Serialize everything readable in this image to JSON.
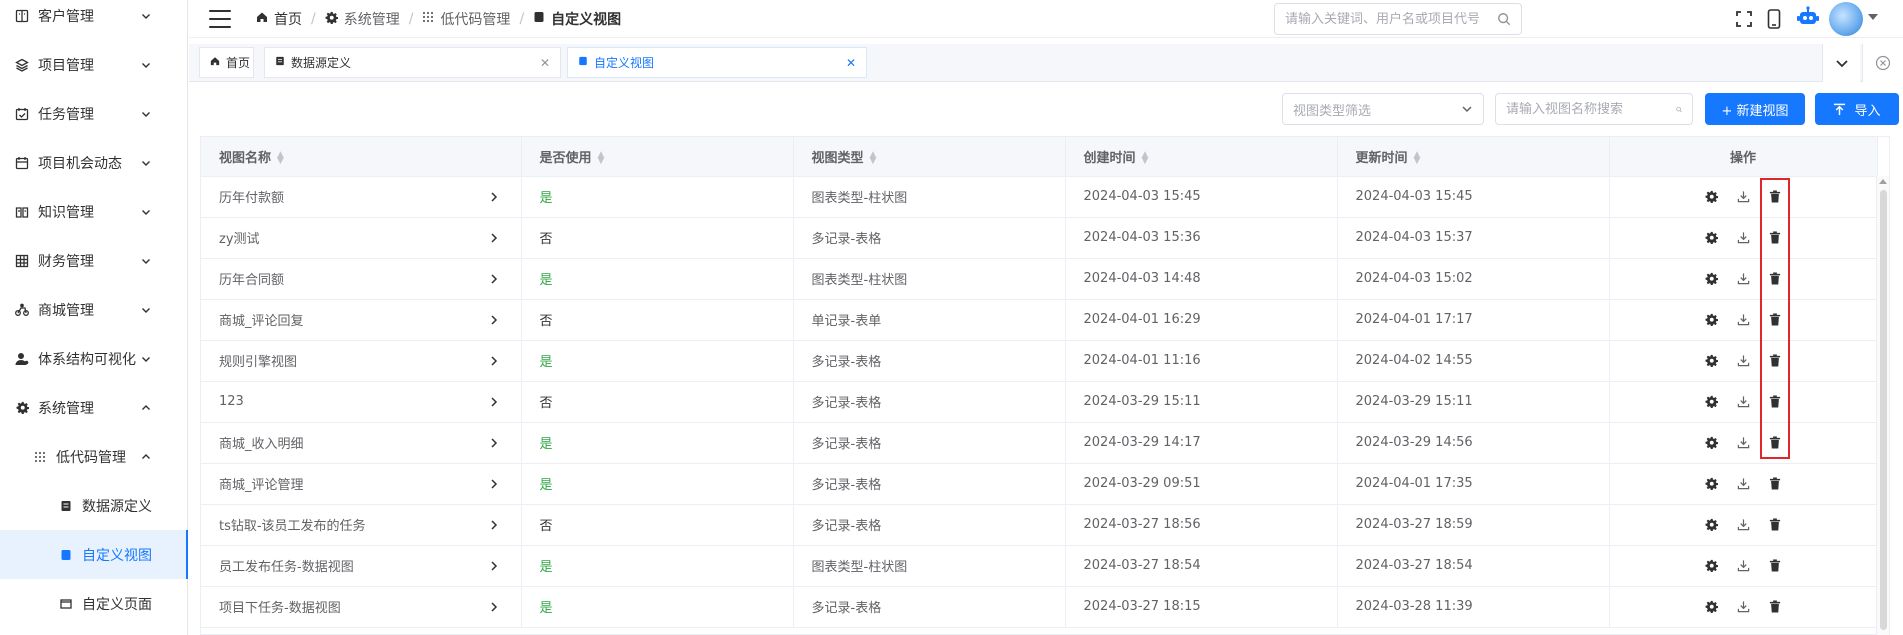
{
  "sidebar": {
    "items": [
      {
        "label": "客户管理",
        "icon": "customer-icon",
        "expanded": false
      },
      {
        "label": "项目管理",
        "icon": "layers-icon",
        "expanded": false
      },
      {
        "label": "任务管理",
        "icon": "calendar-check-icon",
        "expanded": false
      },
      {
        "label": "项目机会动态",
        "icon": "calendar-icon",
        "expanded": false
      },
      {
        "label": "知识管理",
        "icon": "book-icon",
        "expanded": false
      },
      {
        "label": "财务管理",
        "icon": "grid-icon",
        "expanded": false
      },
      {
        "label": "商城管理",
        "icon": "bike-icon",
        "expanded": false
      },
      {
        "label": "体系结构可视化",
        "icon": "user-icon",
        "expanded": false
      },
      {
        "label": "系统管理",
        "icon": "gear-icon",
        "expanded": true
      }
    ],
    "submenu": {
      "label": "低代码管理",
      "icon": "dots-grid-icon",
      "expanded": true
    },
    "subitems": [
      {
        "label": "数据源定义",
        "icon": "database-icon",
        "active": false
      },
      {
        "label": "自定义视图",
        "icon": "view-icon",
        "active": true
      },
      {
        "label": "自定义页面",
        "icon": "window-icon",
        "active": false
      }
    ]
  },
  "header": {
    "breadcrumb": [
      {
        "label": "首页",
        "icon": "home-icon"
      },
      {
        "label": "系统管理",
        "icon": "gear-icon"
      },
      {
        "label": "低代码管理",
        "icon": "dots-grid-icon"
      },
      {
        "label": "自定义视图",
        "icon": "view-icon"
      }
    ],
    "search_placeholder": "请输入关键词、用户名或项目代号"
  },
  "tabs": [
    {
      "label": "首页",
      "icon": "home-icon",
      "closable": false,
      "active": false
    },
    {
      "label": "数据源定义",
      "icon": "database-icon",
      "closable": true,
      "active": false
    },
    {
      "label": "自定义视图",
      "icon": "view-icon",
      "closable": true,
      "active": true
    }
  ],
  "toolbar": {
    "view_type_placeholder": "视图类型筛选",
    "name_search_placeholder": "请输入视图名称搜索",
    "new_view_label": "+ 新建视图",
    "import_label": "导入"
  },
  "table": {
    "columns": [
      "视图名称",
      "是否使用",
      "视图类型",
      "创建时间",
      "更新时间",
      "操作"
    ],
    "rows": [
      {
        "name": "历年付款额",
        "used": "是",
        "type": "图表类型-柱状图",
        "created": "2024-04-03 15:45",
        "updated": "2024-04-03 15:45"
      },
      {
        "name": "zy测试",
        "used": "否",
        "type": "多记录-表格",
        "created": "2024-04-03 15:36",
        "updated": "2024-04-03 15:37"
      },
      {
        "name": "历年合同额",
        "used": "是",
        "type": "图表类型-柱状图",
        "created": "2024-04-03 14:48",
        "updated": "2024-04-03 15:02"
      },
      {
        "name": "商城_评论回复",
        "used": "否",
        "type": "单记录-表单",
        "created": "2024-04-01 16:29",
        "updated": "2024-04-01 17:17"
      },
      {
        "name": "规则引擎视图",
        "used": "是",
        "type": "多记录-表格",
        "created": "2024-04-01 11:16",
        "updated": "2024-04-02 14:55"
      },
      {
        "name": "123",
        "used": "否",
        "type": "多记录-表格",
        "created": "2024-03-29 15:11",
        "updated": "2024-03-29 15:11"
      },
      {
        "name": "商城_收入明细",
        "used": "是",
        "type": "多记录-表格",
        "created": "2024-03-29 14:17",
        "updated": "2024-03-29 14:56"
      },
      {
        "name": "商城_评论管理",
        "used": "是",
        "type": "多记录-表格",
        "created": "2024-03-29 09:51",
        "updated": "2024-04-01 17:35"
      },
      {
        "name": "ts钻取-该员工发布的任务",
        "used": "否",
        "type": "多记录-表格",
        "created": "2024-03-27 18:56",
        "updated": "2024-03-27 18:59"
      },
      {
        "name": "员工发布任务-数据视图",
        "used": "是",
        "type": "图表类型-柱状图",
        "created": "2024-03-27 18:54",
        "updated": "2024-03-27 18:54"
      },
      {
        "name": "项目下任务-数据视图",
        "used": "是",
        "type": "多记录-表格",
        "created": "2024-03-27 18:15",
        "updated": "2024-03-28 11:39"
      }
    ],
    "row_actions": [
      "settings-icon",
      "download-icon",
      "trash-icon"
    ]
  },
  "colors": {
    "primary": "#1677ff",
    "used_yes": "#2ea843",
    "highlight": "#e0262b"
  }
}
